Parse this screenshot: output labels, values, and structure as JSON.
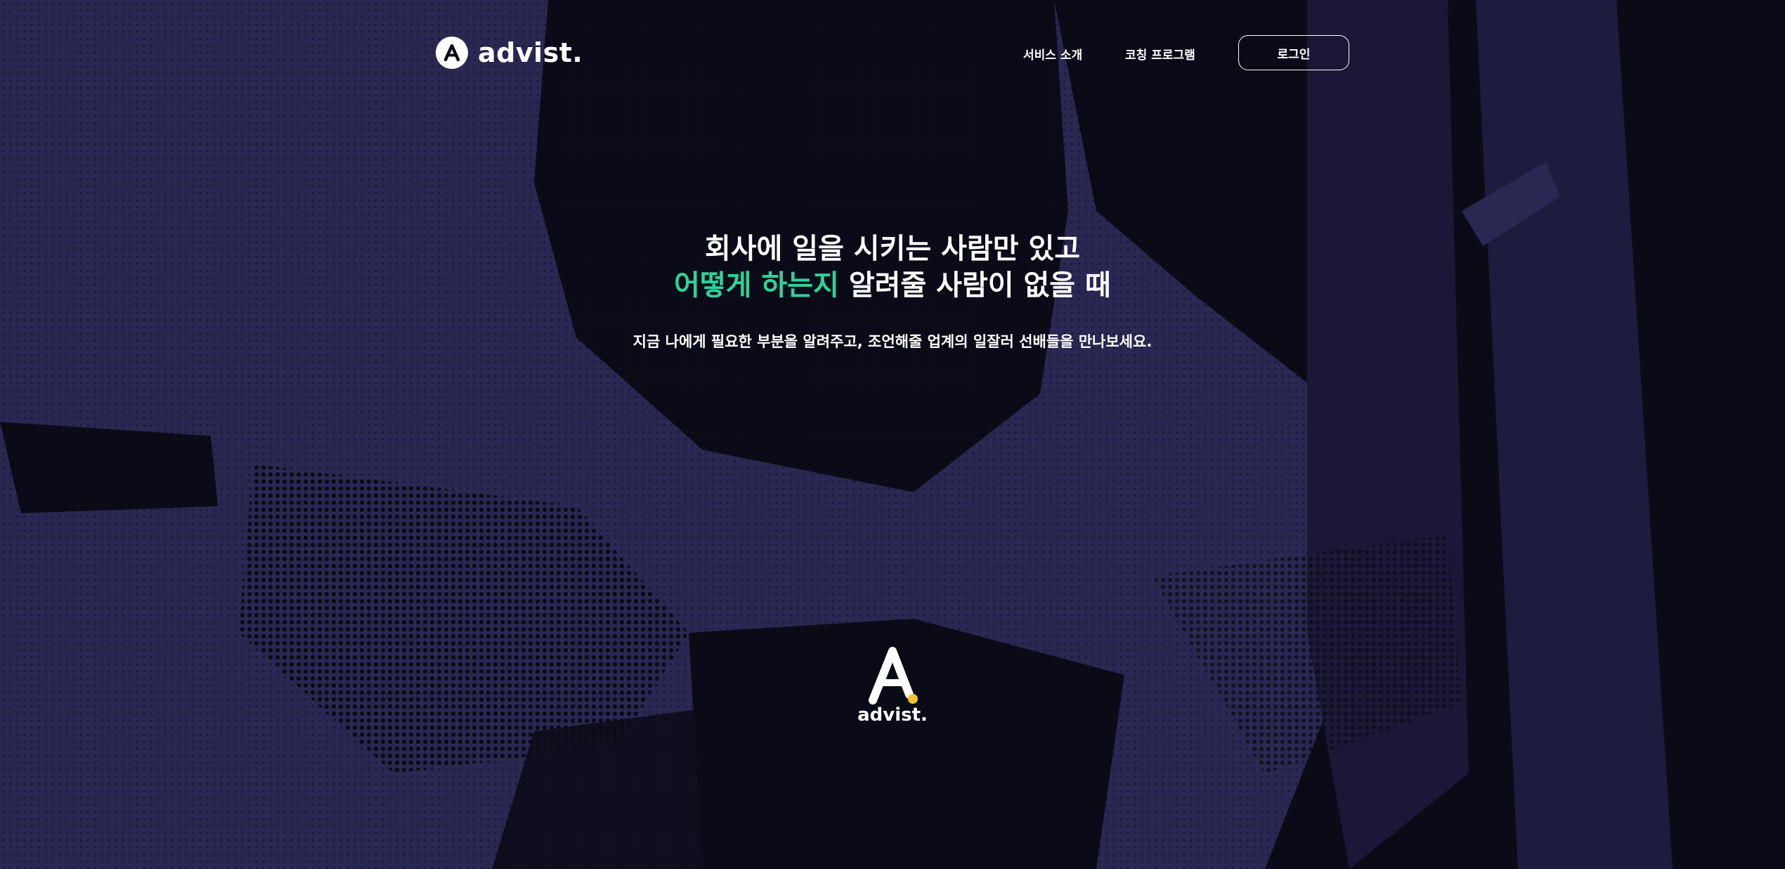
{
  "brand": {
    "name": "advist.",
    "accent_color": "#2fd39a",
    "dot_color": "#f2c230",
    "background_color": "#2a2852"
  },
  "nav": {
    "services": "서비스 소개",
    "coaching": "코칭 프로그램",
    "login": "로그인"
  },
  "hero": {
    "line1": "회사에 일을 시키는 사람만 있고",
    "line2_accent": "어떻게 하는지",
    "line2_rest": " 알려줄 사람이 없을 때",
    "subtitle": "지금 나에게 필요한 부분을 알려주고, 조언해줄 업계의 일잘러 선배들을 만나보세요."
  },
  "icons": {
    "header_logo": "advist-logo-icon",
    "center_logo": "advist-a-mark-icon"
  }
}
